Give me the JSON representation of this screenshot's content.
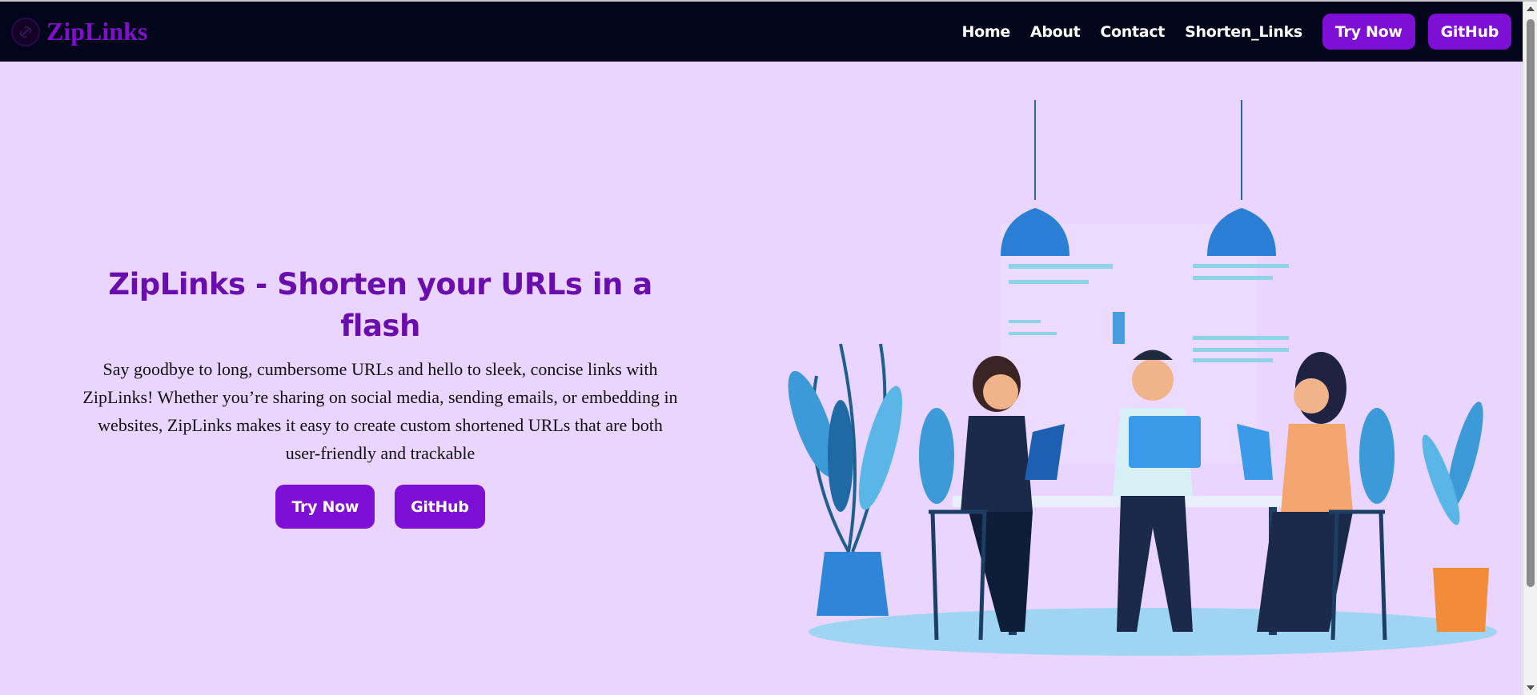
{
  "navbar": {
    "brand": "ZipLinks",
    "links": [
      "Home",
      "About",
      "Contact",
      "Shorten_Links"
    ],
    "try_now": "Try Now",
    "github": "GitHub"
  },
  "hero": {
    "title": "ZipLinks - Shorten your URLs in a flash",
    "description": "Say goodbye to long, cumbersome URLs and hello to sleek, concise links with ZipLinks! Whether you’re sharing on social media, sending emails, or embedding in websites, ZipLinks makes it easy to create custom shortened URLs that are both user-friendly and trackable",
    "try_now": "Try Now",
    "github": "GitHub"
  },
  "colors": {
    "background": "#e9d5ff",
    "navbar": "#03061a",
    "accent": "#7e0fd4",
    "title": "#6a0dad"
  },
  "icons": [
    "link-logo-icon",
    "team-office-illustration"
  ]
}
